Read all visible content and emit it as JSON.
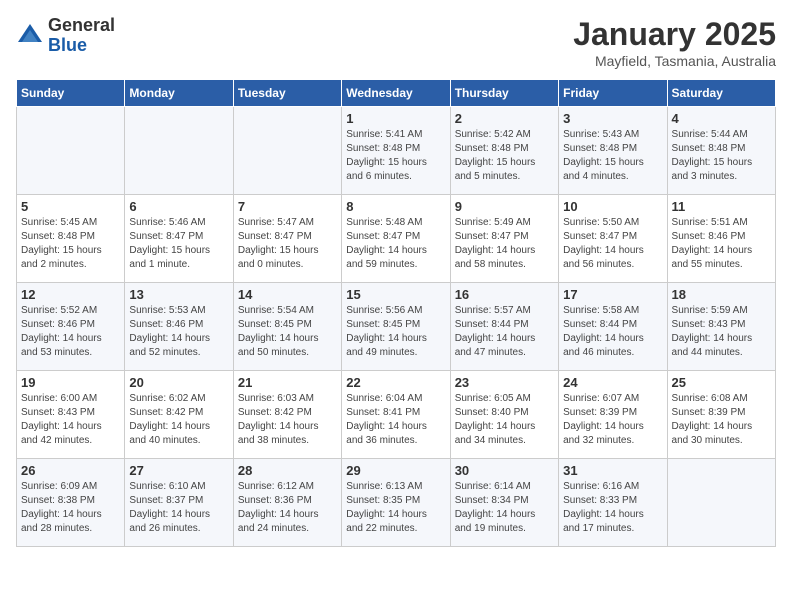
{
  "logo": {
    "general": "General",
    "blue": "Blue"
  },
  "title": {
    "month": "January 2025",
    "location": "Mayfield, Tasmania, Australia"
  },
  "weekdays": [
    "Sunday",
    "Monday",
    "Tuesday",
    "Wednesday",
    "Thursday",
    "Friday",
    "Saturday"
  ],
  "weeks": [
    [
      {
        "day": "",
        "info": ""
      },
      {
        "day": "",
        "info": ""
      },
      {
        "day": "",
        "info": ""
      },
      {
        "day": "1",
        "info": "Sunrise: 5:41 AM\nSunset: 8:48 PM\nDaylight: 15 hours\nand 6 minutes."
      },
      {
        "day": "2",
        "info": "Sunrise: 5:42 AM\nSunset: 8:48 PM\nDaylight: 15 hours\nand 5 minutes."
      },
      {
        "day": "3",
        "info": "Sunrise: 5:43 AM\nSunset: 8:48 PM\nDaylight: 15 hours\nand 4 minutes."
      },
      {
        "day": "4",
        "info": "Sunrise: 5:44 AM\nSunset: 8:48 PM\nDaylight: 15 hours\nand 3 minutes."
      }
    ],
    [
      {
        "day": "5",
        "info": "Sunrise: 5:45 AM\nSunset: 8:48 PM\nDaylight: 15 hours\nand 2 minutes."
      },
      {
        "day": "6",
        "info": "Sunrise: 5:46 AM\nSunset: 8:47 PM\nDaylight: 15 hours\nand 1 minute."
      },
      {
        "day": "7",
        "info": "Sunrise: 5:47 AM\nSunset: 8:47 PM\nDaylight: 15 hours\nand 0 minutes."
      },
      {
        "day": "8",
        "info": "Sunrise: 5:48 AM\nSunset: 8:47 PM\nDaylight: 14 hours\nand 59 minutes."
      },
      {
        "day": "9",
        "info": "Sunrise: 5:49 AM\nSunset: 8:47 PM\nDaylight: 14 hours\nand 58 minutes."
      },
      {
        "day": "10",
        "info": "Sunrise: 5:50 AM\nSunset: 8:47 PM\nDaylight: 14 hours\nand 56 minutes."
      },
      {
        "day": "11",
        "info": "Sunrise: 5:51 AM\nSunset: 8:46 PM\nDaylight: 14 hours\nand 55 minutes."
      }
    ],
    [
      {
        "day": "12",
        "info": "Sunrise: 5:52 AM\nSunset: 8:46 PM\nDaylight: 14 hours\nand 53 minutes."
      },
      {
        "day": "13",
        "info": "Sunrise: 5:53 AM\nSunset: 8:46 PM\nDaylight: 14 hours\nand 52 minutes."
      },
      {
        "day": "14",
        "info": "Sunrise: 5:54 AM\nSunset: 8:45 PM\nDaylight: 14 hours\nand 50 minutes."
      },
      {
        "day": "15",
        "info": "Sunrise: 5:56 AM\nSunset: 8:45 PM\nDaylight: 14 hours\nand 49 minutes."
      },
      {
        "day": "16",
        "info": "Sunrise: 5:57 AM\nSunset: 8:44 PM\nDaylight: 14 hours\nand 47 minutes."
      },
      {
        "day": "17",
        "info": "Sunrise: 5:58 AM\nSunset: 8:44 PM\nDaylight: 14 hours\nand 46 minutes."
      },
      {
        "day": "18",
        "info": "Sunrise: 5:59 AM\nSunset: 8:43 PM\nDaylight: 14 hours\nand 44 minutes."
      }
    ],
    [
      {
        "day": "19",
        "info": "Sunrise: 6:00 AM\nSunset: 8:43 PM\nDaylight: 14 hours\nand 42 minutes."
      },
      {
        "day": "20",
        "info": "Sunrise: 6:02 AM\nSunset: 8:42 PM\nDaylight: 14 hours\nand 40 minutes."
      },
      {
        "day": "21",
        "info": "Sunrise: 6:03 AM\nSunset: 8:42 PM\nDaylight: 14 hours\nand 38 minutes."
      },
      {
        "day": "22",
        "info": "Sunrise: 6:04 AM\nSunset: 8:41 PM\nDaylight: 14 hours\nand 36 minutes."
      },
      {
        "day": "23",
        "info": "Sunrise: 6:05 AM\nSunset: 8:40 PM\nDaylight: 14 hours\nand 34 minutes."
      },
      {
        "day": "24",
        "info": "Sunrise: 6:07 AM\nSunset: 8:39 PM\nDaylight: 14 hours\nand 32 minutes."
      },
      {
        "day": "25",
        "info": "Sunrise: 6:08 AM\nSunset: 8:39 PM\nDaylight: 14 hours\nand 30 minutes."
      }
    ],
    [
      {
        "day": "26",
        "info": "Sunrise: 6:09 AM\nSunset: 8:38 PM\nDaylight: 14 hours\nand 28 minutes."
      },
      {
        "day": "27",
        "info": "Sunrise: 6:10 AM\nSunset: 8:37 PM\nDaylight: 14 hours\nand 26 minutes."
      },
      {
        "day": "28",
        "info": "Sunrise: 6:12 AM\nSunset: 8:36 PM\nDaylight: 14 hours\nand 24 minutes."
      },
      {
        "day": "29",
        "info": "Sunrise: 6:13 AM\nSunset: 8:35 PM\nDaylight: 14 hours\nand 22 minutes."
      },
      {
        "day": "30",
        "info": "Sunrise: 6:14 AM\nSunset: 8:34 PM\nDaylight: 14 hours\nand 19 minutes."
      },
      {
        "day": "31",
        "info": "Sunrise: 6:16 AM\nSunset: 8:33 PM\nDaylight: 14 hours\nand 17 minutes."
      },
      {
        "day": "",
        "info": ""
      }
    ]
  ]
}
